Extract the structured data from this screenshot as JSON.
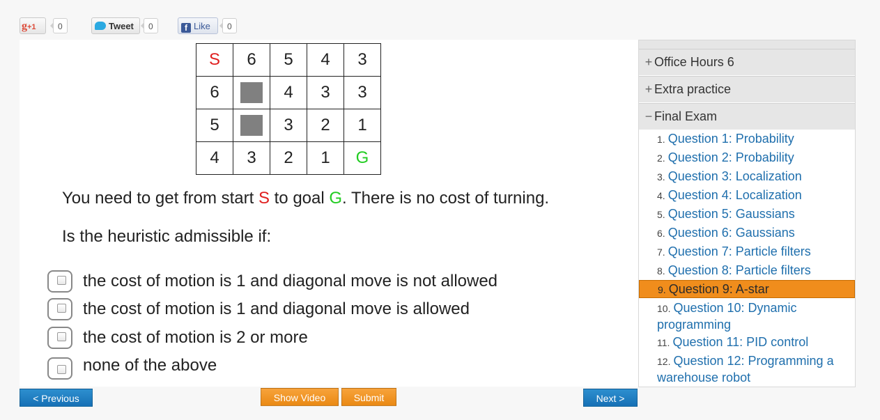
{
  "social": {
    "gplus_label": "+1",
    "gplus_count": "0",
    "tweet_label": "Tweet",
    "tweet_count": "0",
    "like_label": "Like",
    "like_count": "0"
  },
  "grid": {
    "rows": [
      [
        "S",
        "6",
        "5",
        "4",
        "3"
      ],
      [
        "6",
        "",
        "4",
        "3",
        "3"
      ],
      [
        "5",
        "",
        "3",
        "2",
        "1"
      ],
      [
        "4",
        "3",
        "2",
        "1",
        "G"
      ]
    ]
  },
  "question": {
    "line1_a": "You need to get from start ",
    "line1_s": "S",
    "line1_b": " to goal ",
    "line1_g": "G",
    "line1_c": ". There is no cost of turning.",
    "line2": "Is the heuristic admissible if:"
  },
  "options": [
    "the cost of motion is 1 and diagonal move is not allowed",
    "the cost of motion is 1 and diagonal move is allowed",
    "the cost of motion is 2 or more",
    "none of the above"
  ],
  "buttons": {
    "previous": "< Previous",
    "show_video": "Show Video",
    "submit": "Submit",
    "next": "Next >"
  },
  "sidebar": {
    "sections": [
      {
        "sign": "+",
        "label": "Office Hours 6"
      },
      {
        "sign": "+",
        "label": "Extra practice"
      },
      {
        "sign": "−",
        "label": "Final Exam"
      }
    ],
    "items": [
      {
        "num": "1.",
        "title": "Question 1: Probability"
      },
      {
        "num": "2.",
        "title": "Question 2: Probability"
      },
      {
        "num": "3.",
        "title": "Question 3: Localization"
      },
      {
        "num": "4.",
        "title": "Question 4: Localization"
      },
      {
        "num": "5.",
        "title": "Question 5: Gaussians"
      },
      {
        "num": "6.",
        "title": "Question 6: Gaussians"
      },
      {
        "num": "7.",
        "title": "Question 7: Particle filters"
      },
      {
        "num": "8.",
        "title": "Question 8: Particle filters"
      },
      {
        "num": "9.",
        "title": "Question 9: A-star",
        "active": true
      },
      {
        "num": "10.",
        "title": "Question 10: Dynamic programming"
      },
      {
        "num": "11.",
        "title": "Question 11: PID control"
      },
      {
        "num": "12.",
        "title": "Question 12: Programming a warehouse robot"
      }
    ]
  }
}
